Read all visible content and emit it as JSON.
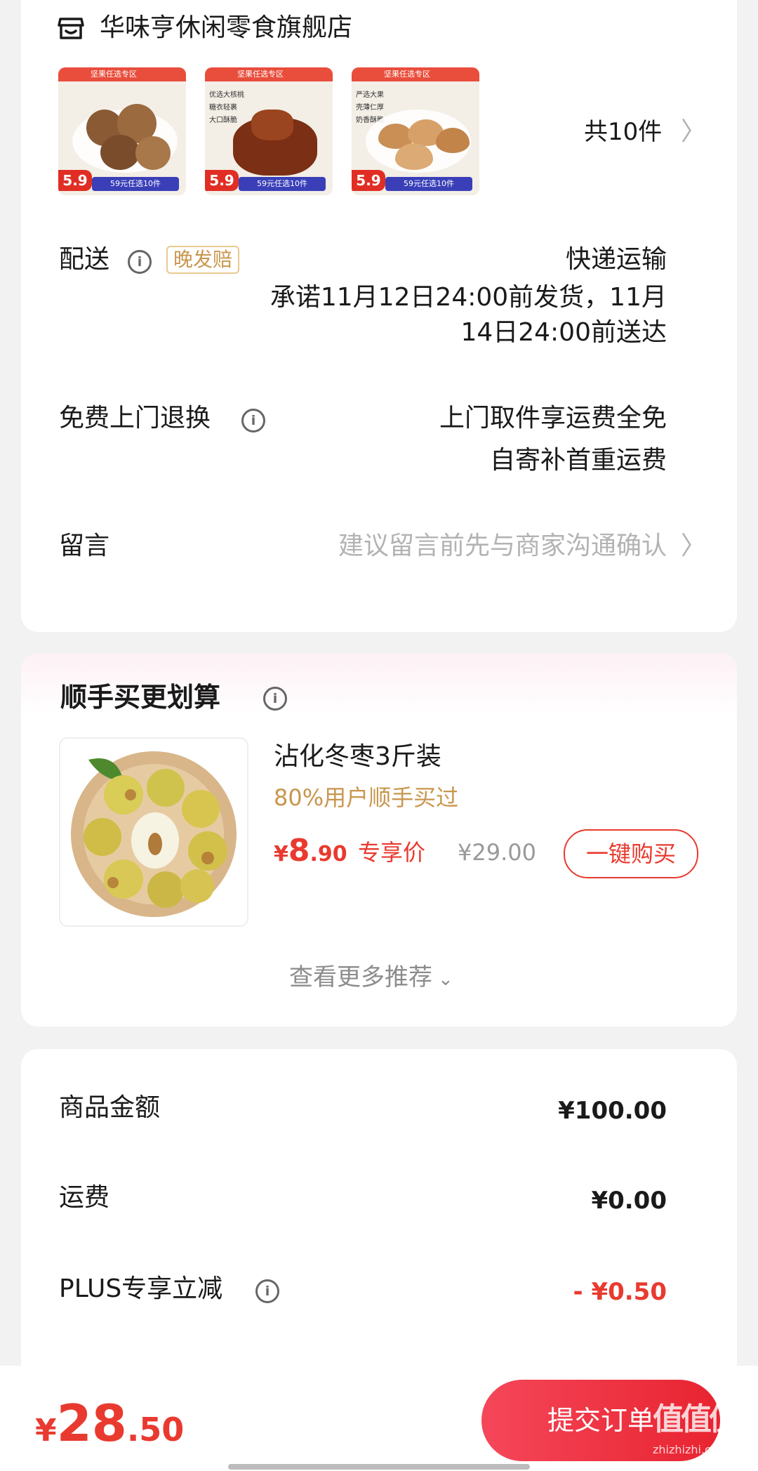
{
  "store": {
    "name": "华味亨休闲零食旗舰店",
    "icon": "store-icon"
  },
  "products": {
    "count_label": "共10件",
    "thumbs": [
      {
        "banner": "坚果任选专区",
        "price": "5.9",
        "promo": "59元任选10件",
        "features": []
      },
      {
        "banner": "坚果任选专区",
        "price": "5.9",
        "promo": "59元任选10件",
        "features": [
          "优选大核桃",
          "糖衣轻裹",
          "大口酥脆"
        ]
      },
      {
        "banner": "坚果任选专区",
        "price": "5.9",
        "promo": "59元任选10件",
        "features": [
          "严选大果",
          "壳薄仁厚",
          "奶香酥脆"
        ]
      }
    ]
  },
  "delivery": {
    "label": "配送",
    "badge": "晚发赔",
    "method": "快递运输",
    "promise_line1": "承诺11月12日24:00前发货，11月",
    "promise_line2": "14日24:00前送达"
  },
  "returns": {
    "label": "免费上门退换",
    "line1": "上门取件享运费全免",
    "line2": "自寄补首重运费"
  },
  "message": {
    "label": "留言",
    "placeholder": "建议留言前先与商家沟通确认"
  },
  "addon": {
    "title": "顺手买更划算",
    "product_name": "沾化冬枣3斤装",
    "social_proof": "80%用户顺手买过",
    "price_symbol": "¥",
    "price_int": "8",
    "price_dec": ".90",
    "price_tag": "专享价",
    "original_price": "¥29.00",
    "buy_button": "一键购买",
    "more_label": "查看更多推荐"
  },
  "summary": {
    "goods_label": "商品金额",
    "goods_value": "¥100.00",
    "shipping_label": "运费",
    "shipping_value": "¥0.00",
    "plus_label": "PLUS专享立减",
    "plus_value": "- ¥0.50"
  },
  "footer": {
    "total_symbol": "¥",
    "total_int": "28",
    "total_dec": ".50",
    "submit_button": "提交订单",
    "watermark": "值值值",
    "watermark_url": "zhizhizhi.com"
  },
  "colors": {
    "accent": "#e93a2f",
    "gold": "#c9964d",
    "badge_border": "#e9c98f"
  }
}
